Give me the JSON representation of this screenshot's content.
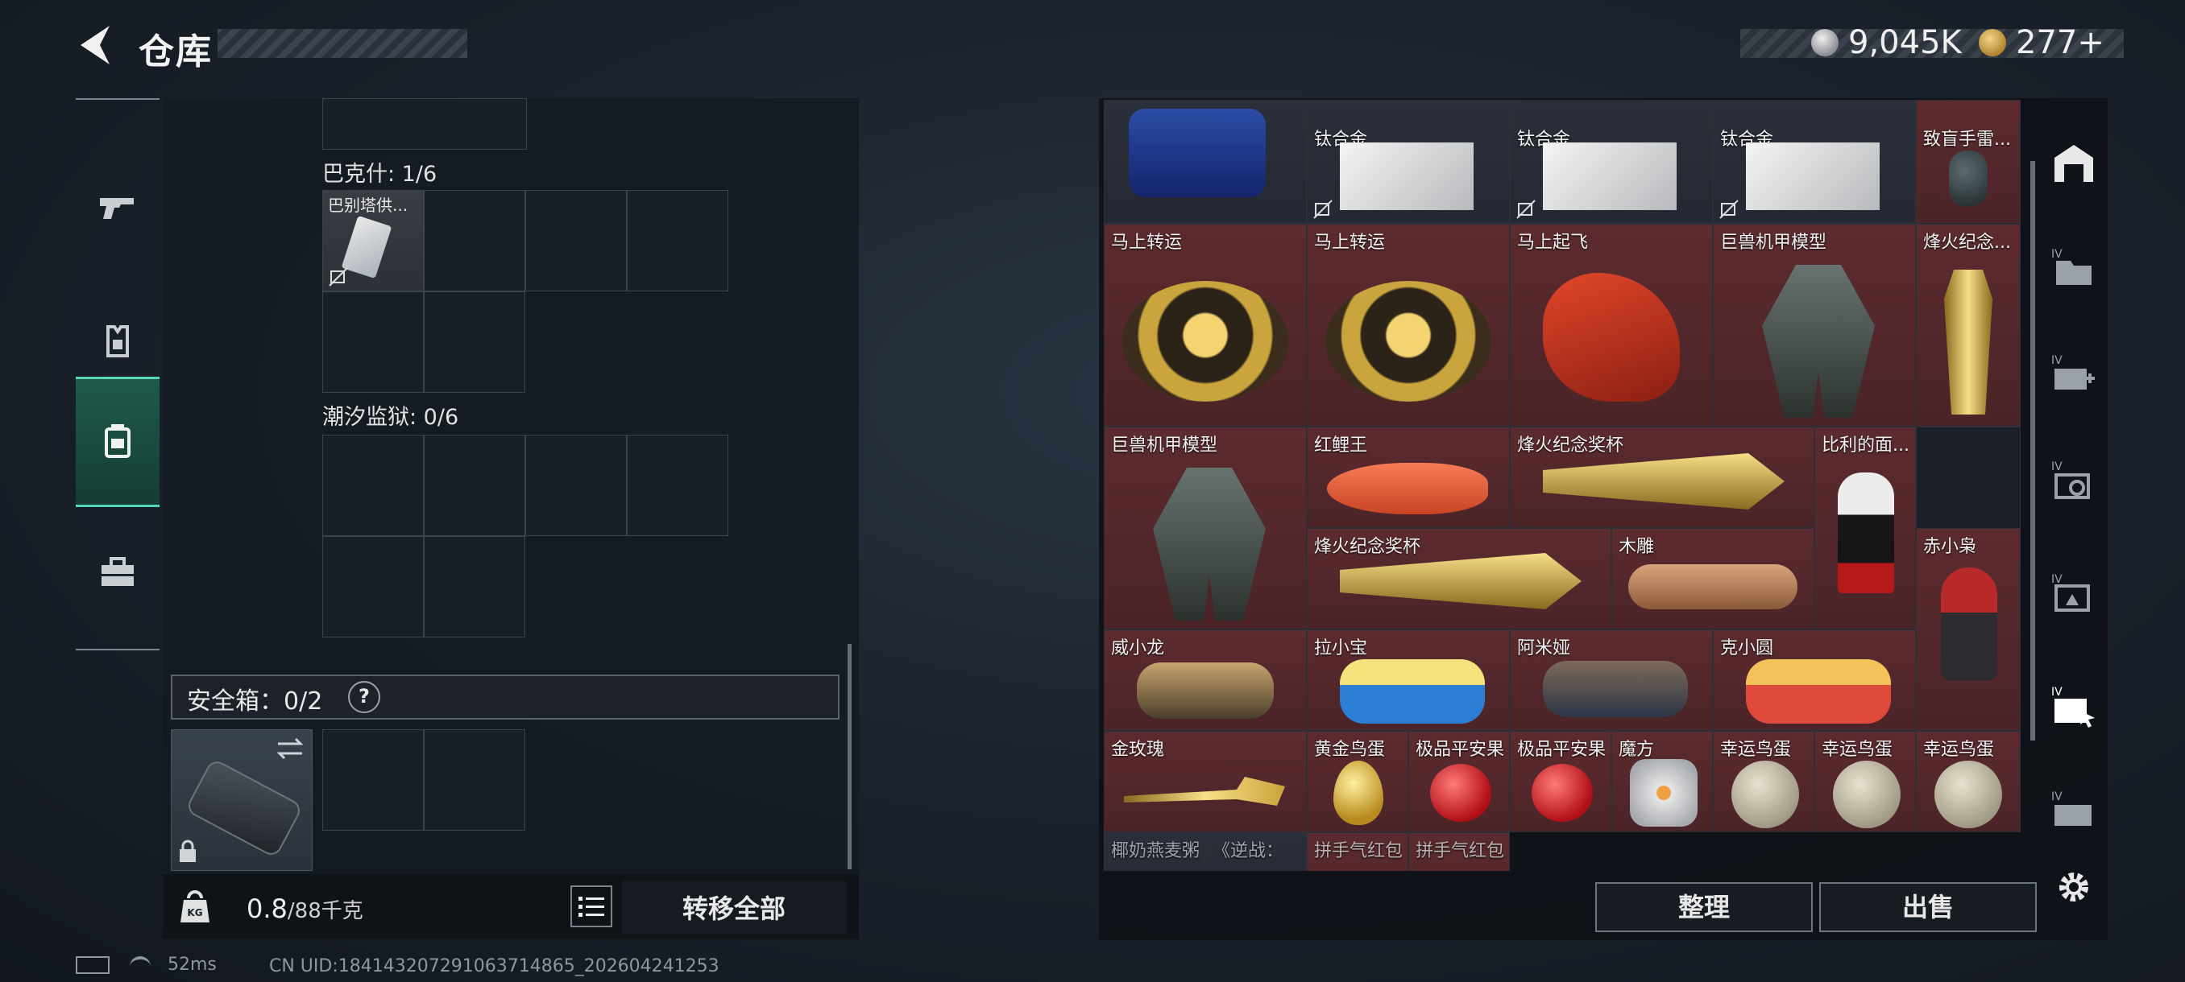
{
  "header": {
    "title": "仓库",
    "currency1": "9,045K",
    "currency2": "277+"
  },
  "left_rail": {
    "items": [
      "weapon-icon",
      "armor-icon",
      "backpack-icon",
      "toolbox-icon"
    ]
  },
  "left": {
    "section_bakeshi": "巴克什: 1/6",
    "item_babieta": "巴别塔供...",
    "section_chaoxi": "潮汐监狱: 0/6",
    "safe_label": "安全箱：0/2",
    "safe_help": "?",
    "weight_value": "0.8",
    "weight_unit": "/88千克",
    "transfer_all": "转移全部"
  },
  "grid": {
    "r0": [
      "钛合金",
      "钛合金",
      "钛合金",
      "致盲手雷..."
    ],
    "r1": [
      "马上转运",
      "马上转运",
      "马上起飞",
      "巨兽机甲模型",
      "烽火纪念..."
    ],
    "r2": [
      "巨兽机甲模型",
      "红鲤王",
      "烽火纪念奖杯",
      "比利的面..."
    ],
    "r3": [
      "烽火纪念奖杯",
      "木雕",
      "赤小枭"
    ],
    "r4": [
      "威小龙",
      "拉小宝",
      "阿米娅",
      "克小圆"
    ],
    "r5": [
      "金玫瑰",
      "黄金鸟蛋",
      "极品平安果",
      "极品平安果",
      "魔方",
      "幸运鸟蛋",
      "幸运鸟蛋",
      "幸运鸟蛋"
    ],
    "r6": [
      "椰奶燕麦粥",
      "《逆战：",
      "拼手气红包",
      "拼手气红包"
    ]
  },
  "buttons": {
    "sort": "整理",
    "sell": "出售"
  },
  "status": {
    "ping": "52ms",
    "uid": "CN UID:18414320729106371486­5_202604241253"
  },
  "colors": {
    "rare_red": "#5c2b2f",
    "accent_green": "#57d7b3"
  }
}
